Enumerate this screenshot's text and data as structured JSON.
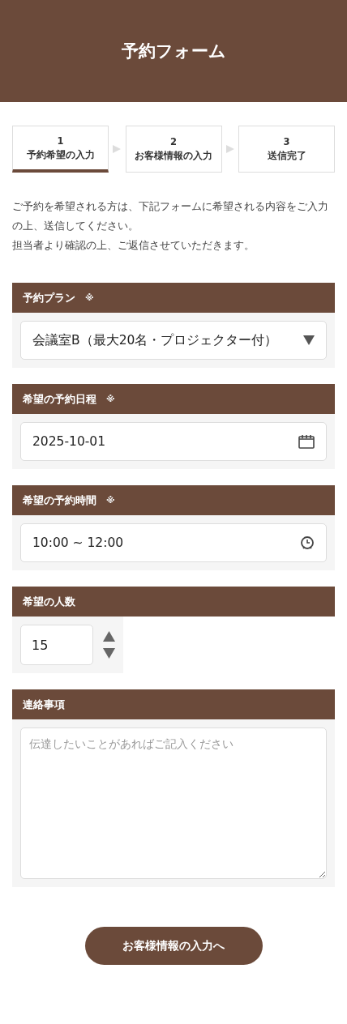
{
  "header": {
    "title": "予約フォーム"
  },
  "steps": [
    {
      "number": "1",
      "label": "予約希望の入力",
      "selected": true
    },
    {
      "number": "2",
      "label": "お客様情報の入力",
      "selected": false
    },
    {
      "number": "3",
      "label": "送信完了",
      "selected": false
    }
  ],
  "intro": [
    "ご予約を希望される方は、下記フォームに希望される内容をご入力の上、送信してください。",
    "担当者より確認の上、ご返信させていただきます。"
  ],
  "fields": [
    {
      "kind": "select",
      "label": "予約プラン",
      "required_mark": "※",
      "value": "会議室B（最大20名・プロジェクター付）"
    },
    {
      "kind": "date",
      "label": "希望の予約日程",
      "required_mark": "※",
      "value": "2025-10-01"
    },
    {
      "kind": "time",
      "label": "希望の予約時間",
      "required_mark": "※",
      "value": "10:00 ~ 12:00"
    },
    {
      "kind": "number",
      "label": "希望の人数",
      "value": "15"
    },
    {
      "kind": "textarea",
      "label": "連絡事項",
      "placeholder": "伝達したいことがあればご記入ください"
    }
  ],
  "submit": {
    "label": "お客様情報の入力へ"
  }
}
